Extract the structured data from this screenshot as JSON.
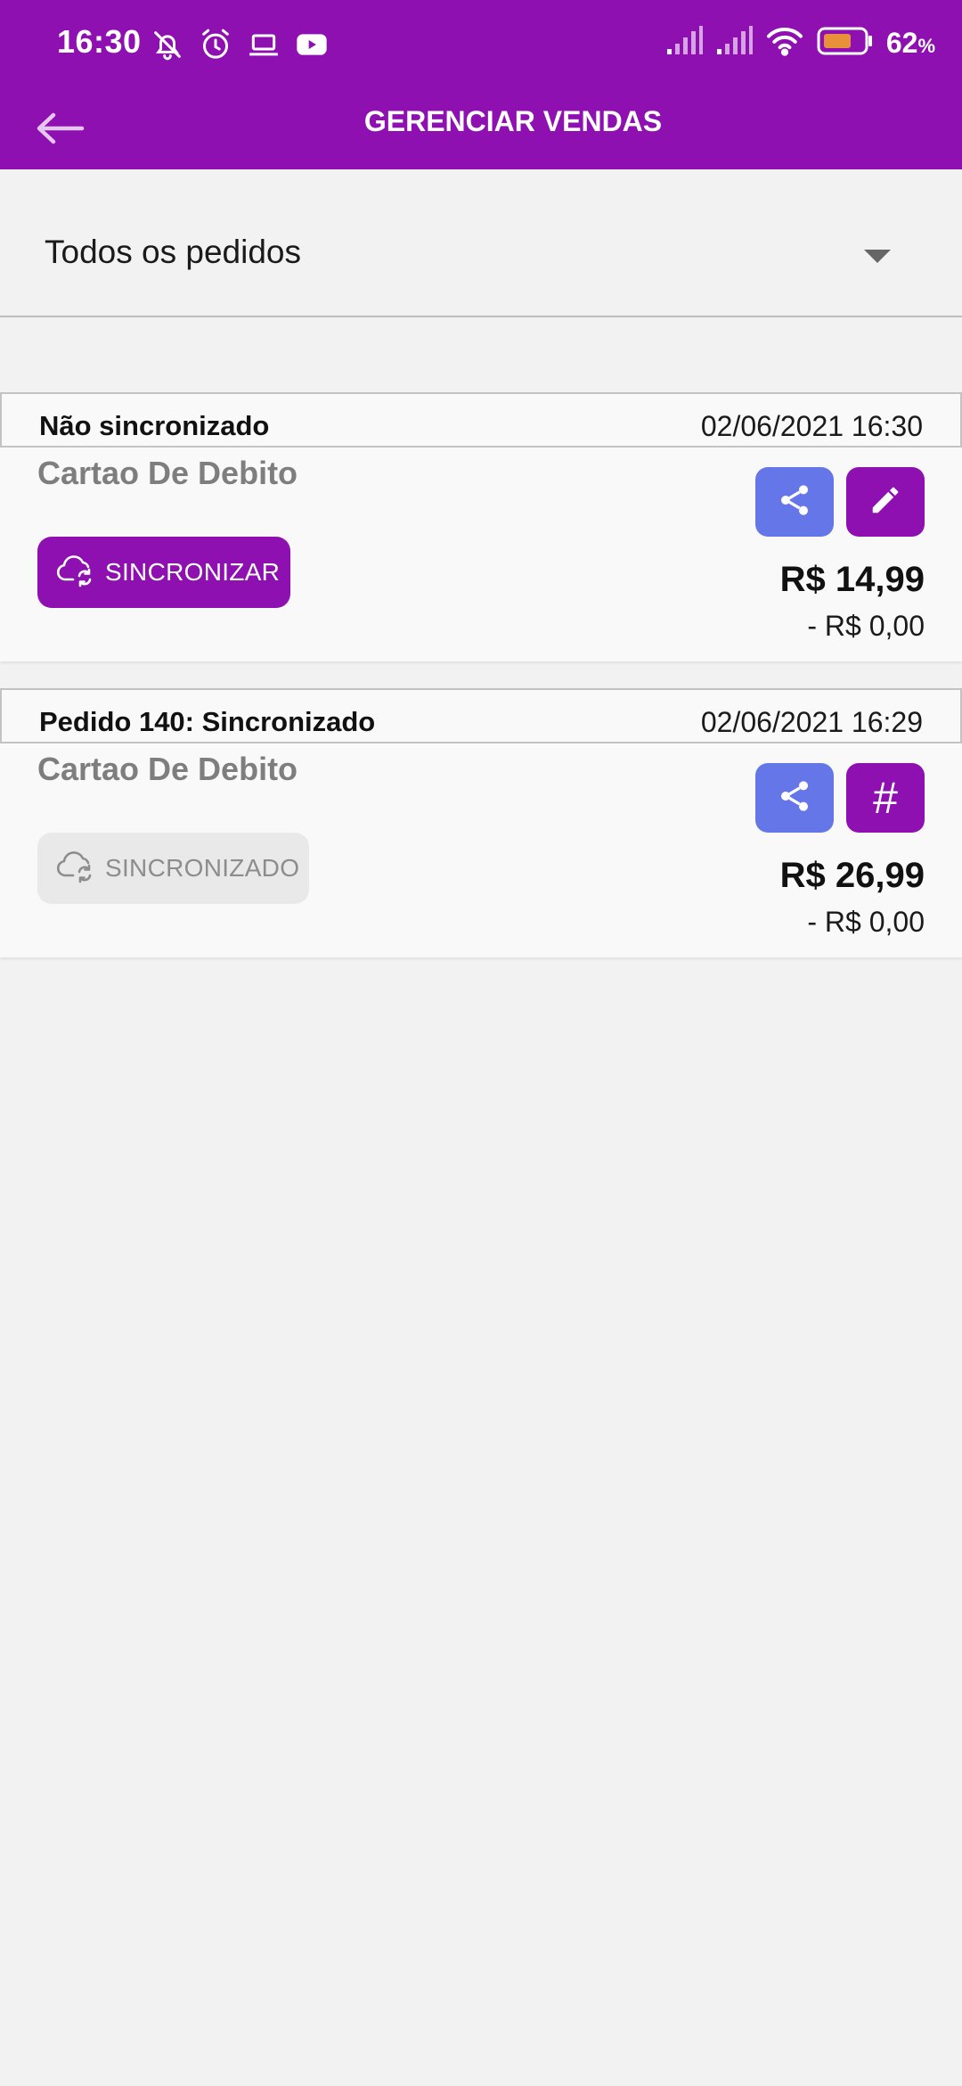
{
  "status_bar": {
    "time": "16:30",
    "battery_percent": "62",
    "battery_unit": "%",
    "icons": [
      "muted-bell-icon",
      "alarm-icon",
      "laptop-icon",
      "youtube-icon",
      "signal-icon",
      "signal-icon",
      "wifi-icon",
      "battery-icon"
    ]
  },
  "app_bar": {
    "title": "GERENCIAR VENDAS",
    "back_icon": "arrow-left-icon"
  },
  "filter": {
    "selected": "Todos os pedidos"
  },
  "orders": [
    {
      "status": "Não sincronizado",
      "datetime": "02/06/2021 16:30",
      "payment": "Cartao De Debito",
      "sync_label": "SINCRONIZAR",
      "total": "R$ 14,99",
      "discount": "- R$ 0,00",
      "secondary_action": "edit-icon"
    },
    {
      "status": "Pedido 140: Sincronizado",
      "datetime": "02/06/2021 16:29",
      "payment": "Cartao De Debito",
      "sync_label": "SINCRONIZADO",
      "total": "R$ 26,99",
      "discount": "- R$ 0,00",
      "secondary_action": "hash-icon",
      "hash_symbol": "#"
    }
  ],
  "colors": {
    "primary": "#8e10b0",
    "share": "#6577e8",
    "background": "#f2f2f2",
    "card": "#f9f9f9",
    "muted_text": "#7e7e7e"
  }
}
